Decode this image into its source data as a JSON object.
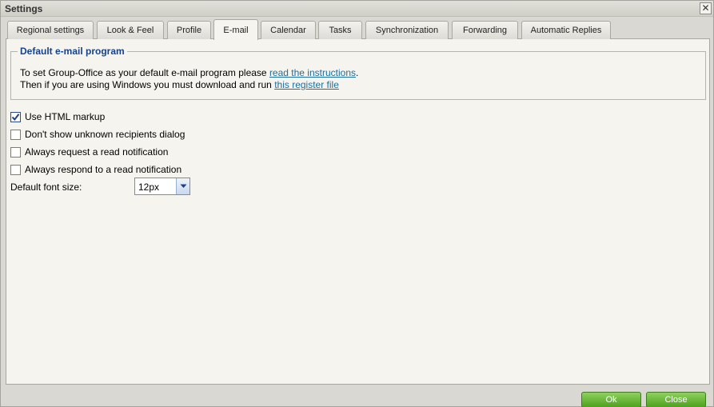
{
  "window": {
    "title": "Settings",
    "close_label": "✕"
  },
  "tabs": [
    {
      "label": "Regional settings"
    },
    {
      "label": "Look & Feel"
    },
    {
      "label": "Profile"
    },
    {
      "label": "E-mail"
    },
    {
      "label": "Calendar"
    },
    {
      "label": "Tasks"
    },
    {
      "label": "Synchronization"
    },
    {
      "label": "Forwarding"
    },
    {
      "label": "Automatic Replies"
    }
  ],
  "active_tab": "E-mail",
  "default_program": {
    "legend": "Default e-mail program",
    "line1_prefix": "To set Group-Office as your default e-mail program please ",
    "line1_link": "read the instructions",
    "line1_suffix": ".",
    "line2_prefix": "Then if you are using Windows you must download and run ",
    "line2_link": "this register file"
  },
  "options": [
    {
      "label": "Use HTML markup",
      "checked": true
    },
    {
      "label": "Don't show unknown recipients dialog",
      "checked": false
    },
    {
      "label": "Always request a read notification",
      "checked": false
    },
    {
      "label": "Always respond to a read notification",
      "checked": false
    }
  ],
  "font_size": {
    "label": "Default font size:",
    "value": "12px"
  },
  "buttons": {
    "ok": "Ok",
    "close": "Close"
  },
  "colors": {
    "accent": "#15428b",
    "link": "#1e6e9e",
    "button_green": "#4ea21e"
  }
}
